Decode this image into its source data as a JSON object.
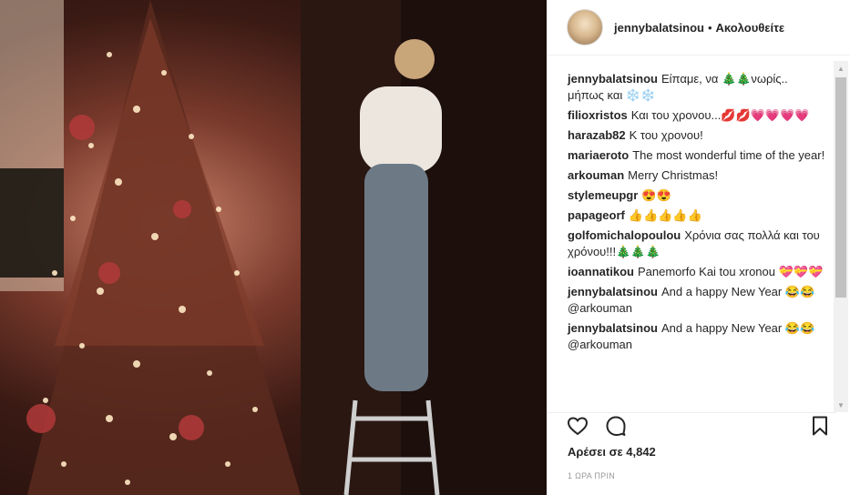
{
  "header": {
    "username": "jennybalatsinou",
    "separator": "•",
    "follow_label": "Ακολουθείτε"
  },
  "comments": [
    {
      "user": "jennybalatsinou",
      "text": "Είπαμε, να 🎄🎄νωρίς.. μήπως και ❄️❄️"
    },
    {
      "user": "filioxristos",
      "text": "Και του χρονου...💋💋💗💗💗💗"
    },
    {
      "user": "harazab82",
      "text": "Κ του χρονου!"
    },
    {
      "user": "mariaeroto",
      "text": "The most wonderful time of the year!"
    },
    {
      "user": "arkouman",
      "text": "Merry Christmas!"
    },
    {
      "user": "stylemeupgr",
      "text": "😍😍"
    },
    {
      "user": "papageorf",
      "text": "👍👍👍👍👍"
    },
    {
      "user": "golfomichalopoulou",
      "text": "Χρόνια σας πολλά και του χρόνου!!!🎄🎄🎄"
    },
    {
      "user": "ioannatikou",
      "text": "Panemorfo Kai tou xronou 💝💝💝"
    },
    {
      "user": "jennybalatsinou",
      "text": "And a happy New Year 😂😂 @arkouman"
    },
    {
      "user": "jennybalatsinou",
      "text": "And a happy New Year 😂😂 @arkouman"
    }
  ],
  "actions": {
    "like_icon": "heart-outline-icon",
    "comment_icon": "comment-bubble-icon",
    "save_icon": "bookmark-icon"
  },
  "likes_label": "Αρέσει σε 4,842",
  "timestamp": "1 ΩΡΑ ΠΡΙΝ",
  "colors": {
    "text": "#262626",
    "muted": "#999999",
    "border": "#efefef"
  }
}
